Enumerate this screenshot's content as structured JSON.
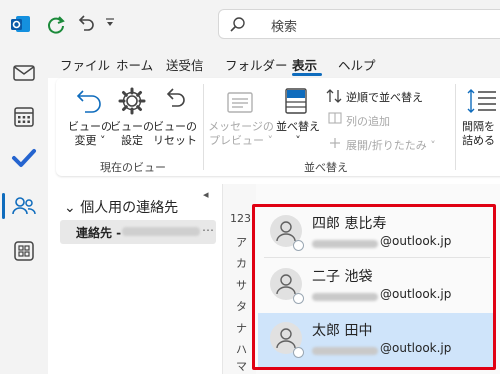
{
  "search": {
    "placeholder": "検索"
  },
  "quick_access": {
    "icons": [
      "outlook-icon",
      "sync-icon",
      "undo-icon",
      "customize-dropdown-icon"
    ]
  },
  "ribbon_tabs": [
    "ファイル",
    "ホーム",
    "送受信",
    "フォルダー",
    "表示",
    "ヘルプ"
  ],
  "ribbon_active_tab": "表示",
  "ribbon": {
    "current_view": {
      "label": "現在のビュー",
      "change_view": [
        "ビューの",
        "変更 ˅"
      ],
      "view_settings": [
        "ビューの",
        "設定"
      ],
      "reset_view": [
        "ビューの",
        "リセット"
      ]
    },
    "message_preview": {
      "line1": "メッセージの",
      "line2": "プレビュー ˅",
      "disabled": true
    },
    "sort": {
      "label": "並べ替え",
      "sort_button": [
        "並べ替え",
        "˅"
      ],
      "reverse_sort": "逆順で並べ替え",
      "add_columns": "列の追加",
      "expand_collapse": "展開/折りたたみ ˅"
    },
    "partial": {
      "line1": "間隔を",
      "line2": "詰める"
    }
  },
  "folders": {
    "header": "個人用の連絡先",
    "item_label": "連絡先 -",
    "item_more": "⋯"
  },
  "index_letters": [
    "123",
    "ア",
    "カ",
    "サ",
    "タ",
    "ナ",
    "ハ",
    "マ"
  ],
  "contacts": [
    {
      "name": "四郎 恵比寿",
      "email_domain": "@outlook.jp",
      "selected": false
    },
    {
      "name": "二子 池袋",
      "email_domain": "@outlook.jp",
      "selected": false
    },
    {
      "name": "太郎 田中",
      "email_domain": "@outlook.jp",
      "selected": true
    }
  ],
  "colors": {
    "accent": "#0f6cbd",
    "highlight_border": "#e00012",
    "selected_row": "#cfe4fa"
  }
}
